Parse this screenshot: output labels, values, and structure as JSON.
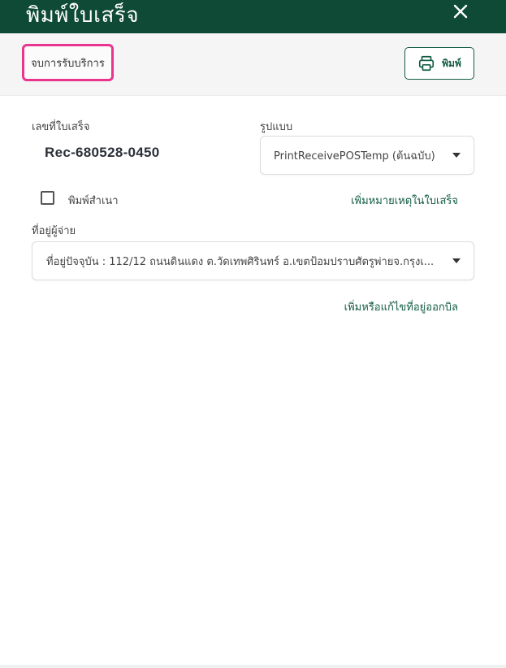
{
  "dialog": {
    "title": "พิมพ์ใบเสร็จ",
    "close_icon": "close-icon"
  },
  "toolbar": {
    "service_chip_label": "จบการรับบริการ",
    "print_button_label": "พิมพ์",
    "print_icon": "printer-icon"
  },
  "form": {
    "receipt_no_label": "เลขที่ใบเสร็จ",
    "receipt_no_value": "Rec-680528-0450",
    "format_label": "รูปแบบ",
    "format_value": "PrintReceivePOSTemp (ต้นฉบับ)",
    "print_copy_label": "พิมพ์สำเนา",
    "print_copy_checked": false,
    "add_note_link": "เพิ่มหมายเหตุในใบเสร็จ",
    "payer_address_label": "ที่อยู่ผู้จ่าย",
    "payer_address_value": "ที่อยู่ปัจจุบัน : 112/12 ถนนดินแดง ต.วัดเทพศิรินทร์ อ.เขตป้อมปราบศัตรูพ่ายจ.กรุงเ...",
    "add_edit_address_link": "เพิ่มหรือแก้ไขที่อยู่ออกบิล"
  },
  "colors": {
    "header_bg": "#0e4a36",
    "accent_green": "#135c42",
    "highlight_pink": "#e9358f"
  }
}
